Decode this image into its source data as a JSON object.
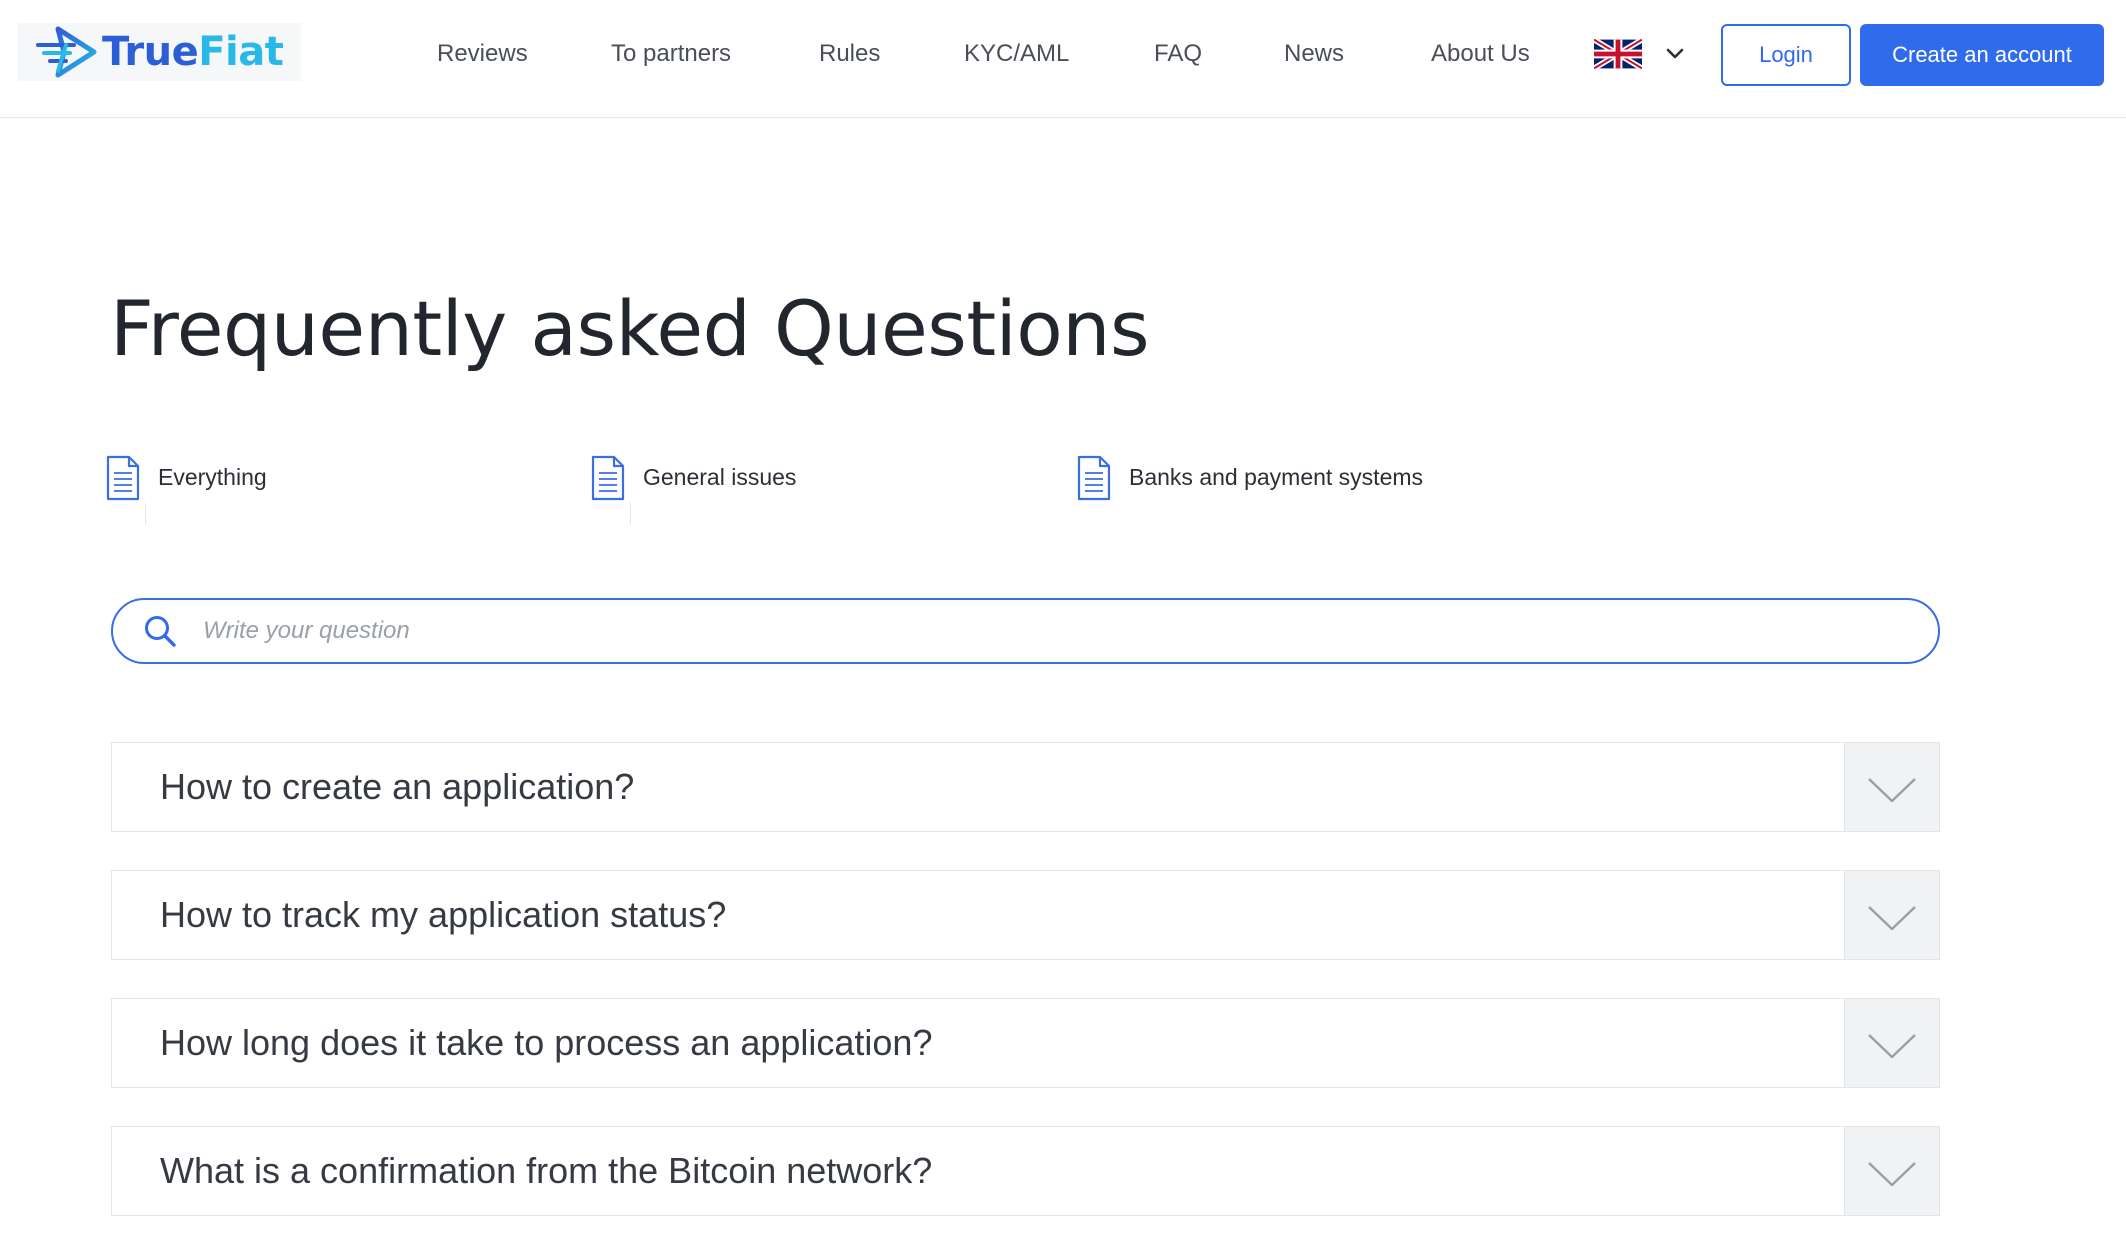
{
  "header": {
    "logo": {
      "part1": "True",
      "part2": "Fiat"
    },
    "nav": [
      {
        "label": "Reviews"
      },
      {
        "label": "To partners"
      },
      {
        "label": "Rules"
      },
      {
        "label": "KYC/AML"
      },
      {
        "label": "FAQ"
      },
      {
        "label": "News"
      },
      {
        "label": "About Us"
      }
    ],
    "language": {
      "flag_icon": "uk-flag-icon",
      "chevron_icon": "chevron-down-icon"
    },
    "login_label": "Login",
    "create_label": "Create an account"
  },
  "page": {
    "title": "Frequently asked Questions"
  },
  "categories": [
    {
      "label": "Everything",
      "icon": "document-icon"
    },
    {
      "label": "General issues",
      "icon": "document-icon"
    },
    {
      "label": "Banks and payment systems",
      "icon": "document-icon"
    }
  ],
  "search": {
    "placeholder": "Write your question",
    "value": "",
    "icon": "search-icon"
  },
  "faq": [
    {
      "question": "How to create an application?"
    },
    {
      "question": "How to track my application status?"
    },
    {
      "question": "How long does it take to process an application?"
    },
    {
      "question": "What is a confirmation from the Bitcoin network?"
    }
  ],
  "colors": {
    "accent": "#2f6bea",
    "logo_blue": "#2c5fd6",
    "logo_cyan": "#29b9e8",
    "toggle_bg": "#f1f2f4",
    "border": "#e2e5e9"
  }
}
